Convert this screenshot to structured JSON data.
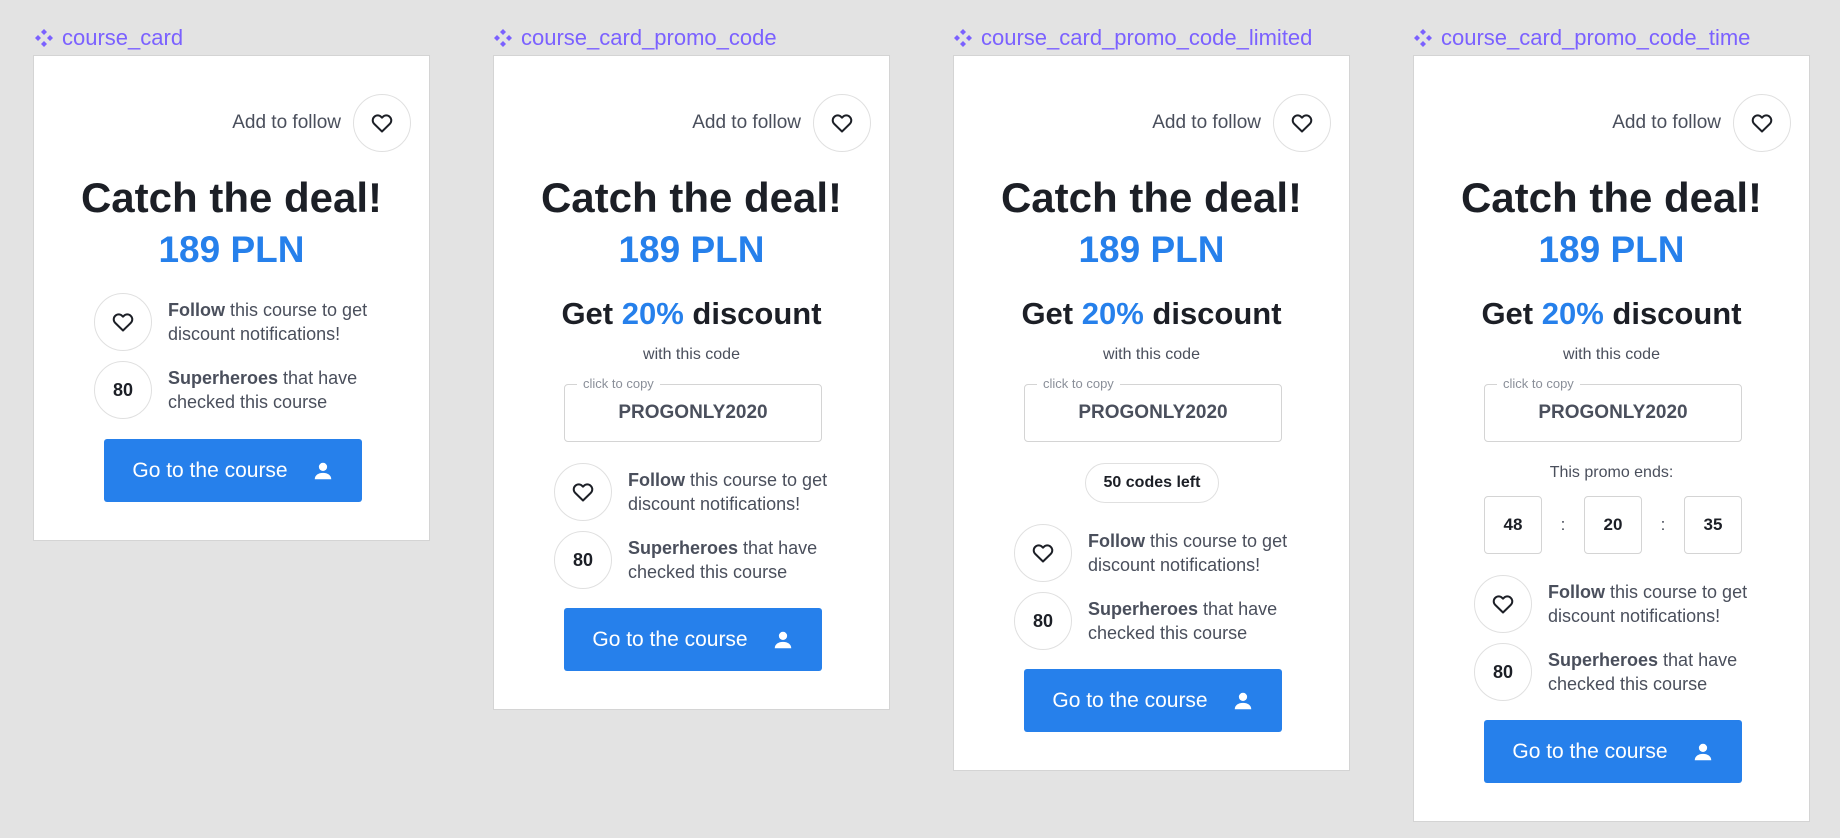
{
  "colors": {
    "accent": "#2680eb",
    "component_label": "#7b61ff",
    "text_dark": "#1c1f26",
    "text_muted": "#4a4f5c",
    "canvas": "#e3e3e3"
  },
  "icons": {
    "component": "component-diamond-icon",
    "heart": "heart-icon",
    "user": "user-icon"
  },
  "cards": [
    {
      "frame_name": "course_card",
      "follow_label": "Add to follow",
      "headline": "Catch the deal!",
      "price": "189 PLN",
      "follow_info": {
        "bold": "Follow",
        "rest": " this course to get discount notifications!"
      },
      "heroes_count": "80",
      "heroes_info": {
        "bold": "Superheroes",
        "rest": " that have checked this course"
      },
      "cta_label": "Go to the course"
    },
    {
      "frame_name": "course_card_promo_code",
      "follow_label": "Add to follow",
      "headline": "Catch the deal!",
      "price": "189 PLN",
      "discount": {
        "prefix": "Get ",
        "percent": "20%",
        "suffix": " discount"
      },
      "with_code": "with this code",
      "code_hint": "click to copy",
      "code": "PROGONLY2020",
      "follow_info": {
        "bold": "Follow",
        "rest": " this course to get discount notifications!"
      },
      "heroes_count": "80",
      "heroes_info": {
        "bold": "Superheroes",
        "rest": " that have checked this course"
      },
      "cta_label": "Go to the course"
    },
    {
      "frame_name": "course_card_promo_code_limited",
      "follow_label": "Add to follow",
      "headline": "Catch the deal!",
      "price": "189 PLN",
      "discount": {
        "prefix": "Get ",
        "percent": "20%",
        "suffix": " discount"
      },
      "with_code": "with this code",
      "code_hint": "click to copy",
      "code": "PROGONLY2020",
      "codes_left": "50 codes left",
      "follow_info": {
        "bold": "Follow",
        "rest": " this course to get discount notifications!"
      },
      "heroes_count": "80",
      "heroes_info": {
        "bold": "Superheroes",
        "rest": " that have checked this course"
      },
      "cta_label": "Go to the course"
    },
    {
      "frame_name": "course_card_promo_code_time",
      "follow_label": "Add to follow",
      "headline": "Catch the deal!",
      "price": "189 PLN",
      "discount": {
        "prefix": "Get ",
        "percent": "20%",
        "suffix": " discount"
      },
      "with_code": "with this code",
      "code_hint": "click to copy",
      "code": "PROGONLY2020",
      "promo_ends": "This promo ends:",
      "timer": {
        "hours": "48",
        "minutes": "20",
        "seconds": "35",
        "sep": ":"
      },
      "follow_info": {
        "bold": "Follow",
        "rest": " this course to get discount notifications!"
      },
      "heroes_count": "80",
      "heroes_info": {
        "bold": "Superheroes",
        "rest": " that have checked this course"
      },
      "cta_label": "Go to the course"
    }
  ]
}
